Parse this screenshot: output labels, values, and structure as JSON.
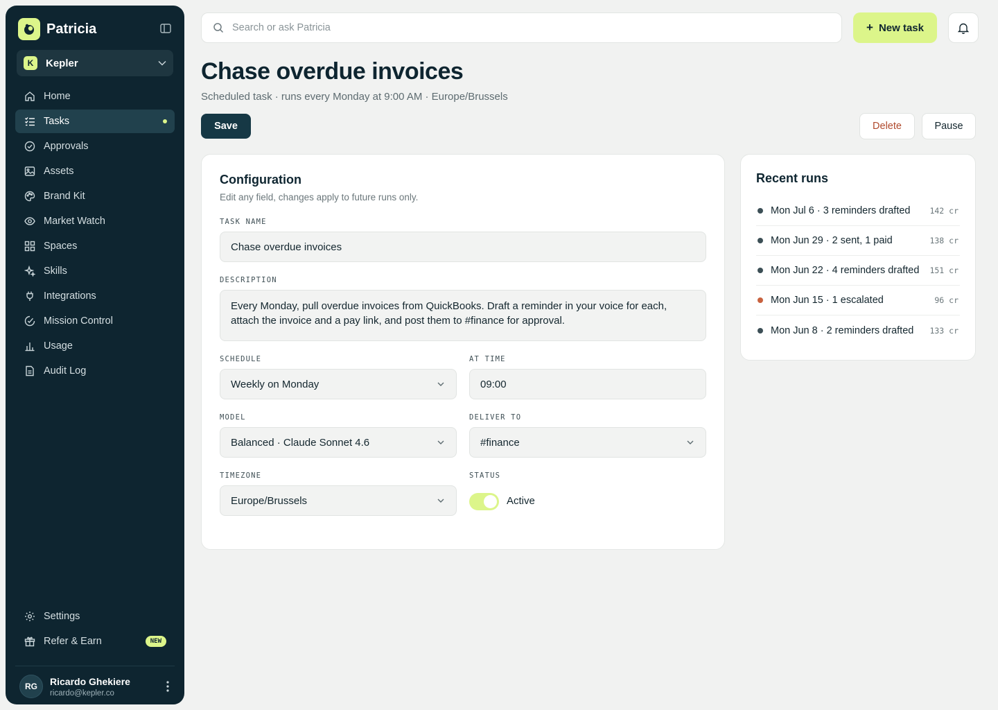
{
  "brand": {
    "name": "Patricia"
  },
  "workspace": {
    "initial": "K",
    "name": "Kepler"
  },
  "nav": {
    "items": [
      {
        "label": "Home",
        "icon": "home-icon"
      },
      {
        "label": "Tasks",
        "icon": "tasks-icon",
        "active": true
      },
      {
        "label": "Approvals",
        "icon": "check-circle-icon"
      },
      {
        "label": "Assets",
        "icon": "image-icon"
      },
      {
        "label": "Brand Kit",
        "icon": "palette-icon"
      },
      {
        "label": "Market Watch",
        "icon": "eye-icon"
      },
      {
        "label": "Spaces",
        "icon": "grid-icon"
      },
      {
        "label": "Skills",
        "icon": "sparkle-icon"
      },
      {
        "label": "Integrations",
        "icon": "plug-icon"
      },
      {
        "label": "Mission Control",
        "icon": "gauge-icon"
      },
      {
        "label": "Usage",
        "icon": "bar-chart-icon"
      },
      {
        "label": "Audit Log",
        "icon": "document-icon"
      }
    ],
    "bottom": [
      {
        "label": "Settings",
        "icon": "gear-icon"
      },
      {
        "label": "Refer & Earn",
        "icon": "gift-icon",
        "badge": "NEW"
      }
    ]
  },
  "user": {
    "initials": "RG",
    "name": "Ricardo Ghekiere",
    "email": "ricardo@kepler.co"
  },
  "search": {
    "placeholder": "Search or ask Patricia"
  },
  "toolbar": {
    "new_task_label": "New task",
    "new_task_plus": "+"
  },
  "header": {
    "title": "Chase overdue invoices",
    "subtitle": "Scheduled task · runs every Monday at 9:00 AM · Europe/Brussels",
    "save_label": "Save",
    "delete_label": "Delete",
    "pause_label": "Pause"
  },
  "config": {
    "title": "Configuration",
    "subtitle": "Edit any field, changes apply to future runs only.",
    "task_name_label": "TASK NAME",
    "task_name_value": "Chase overdue invoices",
    "description_label": "DESCRIPTION",
    "description_value": "Every Monday, pull overdue invoices from QuickBooks. Draft a reminder in your voice for each, attach the invoice and a pay link, and post them to #finance for approval.",
    "schedule_label": "SCHEDULE",
    "schedule_value": "Weekly on Monday",
    "time_label": "AT TIME",
    "time_value": "09:00",
    "model_label": "MODEL",
    "model_value": "Balanced · Claude Sonnet 4.6",
    "deliver_label": "DELIVER TO",
    "deliver_value": "#finance",
    "timezone_label": "TIMEZONE",
    "timezone_value": "Europe/Brussels",
    "status_label": "STATUS",
    "status_value": "Active",
    "status_on": true
  },
  "runs": {
    "title": "Recent runs",
    "items": [
      {
        "text": "Mon Jul 6 · 3 reminders drafted",
        "cost": "142 cr",
        "status": "ok"
      },
      {
        "text": "Mon Jun 29 · 2 sent, 1 paid",
        "cost": "138 cr",
        "status": "ok"
      },
      {
        "text": "Mon Jun 22 · 4 reminders drafted",
        "cost": "151 cr",
        "status": "ok"
      },
      {
        "text": "Mon Jun 15 · 1 escalated",
        "cost": "96 cr",
        "status": "escalated"
      },
      {
        "text": "Mon Jun 8 · 2 reminders drafted",
        "cost": "133 cr",
        "status": "ok"
      }
    ]
  },
  "colors": {
    "sidebar_bg": "#0e2530",
    "accent": "#dcf58a",
    "primary_button": "#163845",
    "danger_text": "#b04a2d",
    "run_ok_dot": "#3c4f56",
    "run_escalated_dot": "#c8623f"
  }
}
